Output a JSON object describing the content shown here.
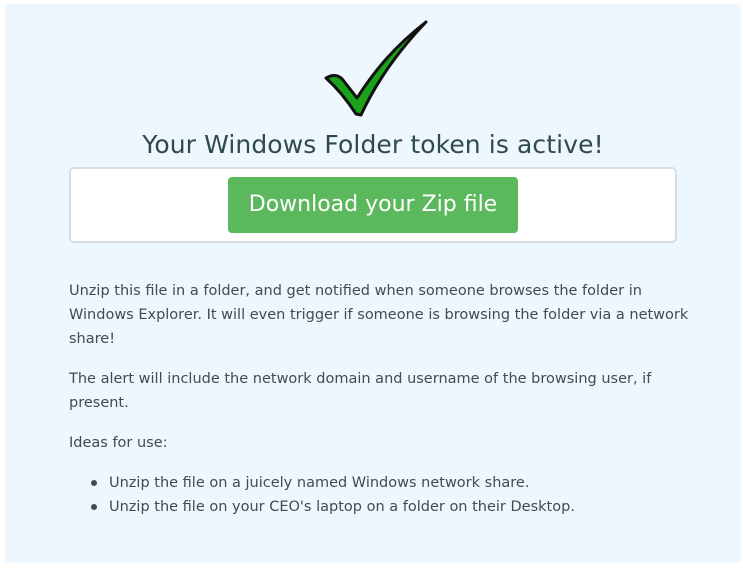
{
  "heading": "Your Windows Folder token is active!",
  "download_button": "Download your Zip file",
  "paragraphs": [
    "Unzip this file in a folder, and get notified when someone browses the folder in Windows Explorer. It will even trigger if someone is browsing the folder via a network share!",
    "The alert will include the network domain and username of the browsing user, if present.",
    "Ideas for use:"
  ],
  "ideas": [
    "Unzip the file on a juicely named Windows network share.",
    "Unzip the file on your CEO's laptop on a folder on their Desktop."
  ],
  "icons": {
    "success": "checkmark-icon"
  },
  "colors": {
    "panel_background": "#eef6fe",
    "button_green": "#5cb85c",
    "check_green": "#1aa31a"
  }
}
